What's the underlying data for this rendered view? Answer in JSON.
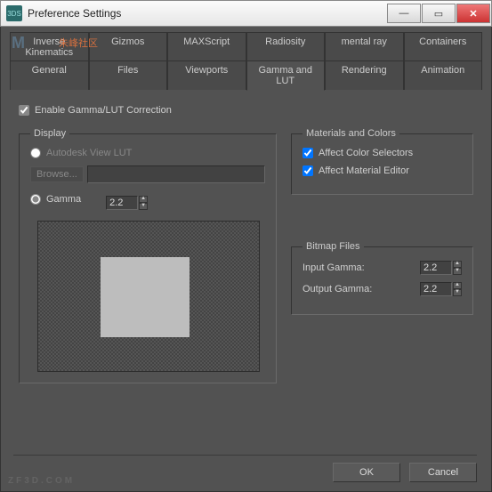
{
  "title": "Preference Settings",
  "watermark": {
    "logo": "M",
    "text": "朱峰社区",
    "footer": "ZF3D.COM"
  },
  "tabs_row1": [
    "Inverse Kinematics",
    "Gizmos",
    "MAXScript",
    "Radiosity",
    "mental ray",
    "Containers"
  ],
  "tabs_row2": [
    "General",
    "Files",
    "Viewports",
    "Gamma and LUT",
    "Rendering",
    "Animation"
  ],
  "active_tab": "Gamma and LUT",
  "enable_label": "Enable Gamma/LUT Correction",
  "enable_checked": true,
  "display": {
    "legend": "Display",
    "autodesk_label": "Autodesk View LUT",
    "browse_label": "Browse...",
    "gamma_label": "Gamma",
    "gamma_value": "2.2",
    "gamma_selected": true
  },
  "materials": {
    "legend": "Materials and Colors",
    "affect_selectors": {
      "label": "Affect Color Selectors",
      "checked": true
    },
    "affect_editor": {
      "label": "Affect Material Editor",
      "checked": true
    }
  },
  "bitmap": {
    "legend": "Bitmap Files",
    "input_label": "Input Gamma:",
    "input_value": "2.2",
    "output_label": "Output Gamma:",
    "output_value": "2.2"
  },
  "buttons": {
    "ok": "OK",
    "cancel": "Cancel"
  }
}
